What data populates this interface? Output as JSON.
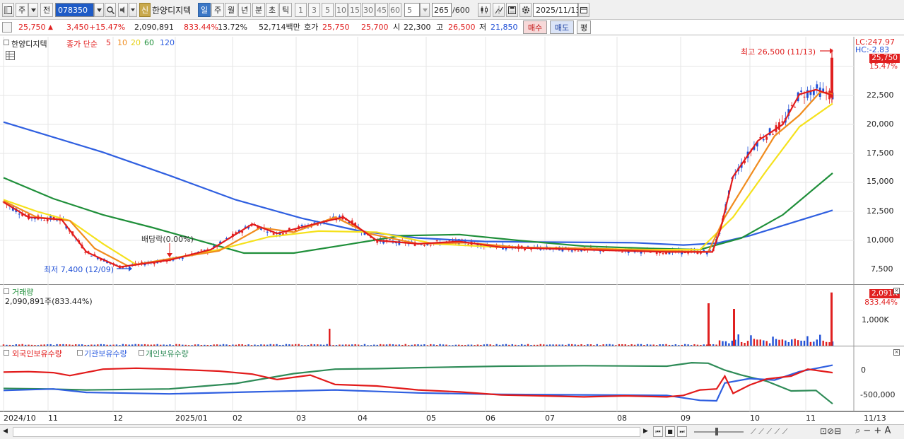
{
  "toolbar": {
    "mode": "주",
    "prev_label": "전",
    "code": "078350",
    "new_badge": "신",
    "stock_name": "한양디지텍",
    "periods": [
      "일",
      "주",
      "월",
      "년",
      "분",
      "초",
      "틱"
    ],
    "minutes": [
      "1",
      "3",
      "5",
      "10",
      "15",
      "30",
      "45",
      "60"
    ],
    "interval_value": "5",
    "count": "265",
    "count_max": "/600",
    "date": "2025/11/13",
    "icons": [
      "window-icon",
      "dropdown-icon",
      "search-icon",
      "speaker-icon",
      "chart-toggle-icon",
      "crosshair-icon",
      "save-icon",
      "settings-icon"
    ]
  },
  "quote": {
    "price": "25,750",
    "change": "3,450",
    "change_pct": "+15.47%",
    "volume": "2,090,891",
    "volume_pct": "833.44%",
    "turnover": "13.72%",
    "amount": "52,714백만",
    "hoga_label": "호가",
    "ask": "25,750",
    "bid": "25,700",
    "open_label": "시",
    "open": "22,300",
    "high_label": "고",
    "high": "26,500",
    "low_label": "저",
    "low": "21,850",
    "buy_label": "매수",
    "sell_label": "매도",
    "eval_label": "평"
  },
  "price_pane": {
    "name": "한양디지텍",
    "series_label": "종가 단순",
    "ma_periods": [
      "5",
      "10",
      "20",
      "60",
      "120"
    ],
    "ma_colors": [
      "#e21b1b",
      "#f08c1e",
      "#f5e11c",
      "#1f8f3a",
      "#2f5fe0"
    ],
    "lc": "LC:247.97",
    "hc": "HC:-2.83",
    "price_tag": "25,750",
    "pct_tag": "15.47%",
    "high_note": "최고 26,500 (11/13)",
    "low_note": "최저 7,400 (12/09)",
    "dividend_note": "배당락(0.00%)",
    "y_ticks": [
      "22,500",
      "20,000",
      "17,500",
      "15,000",
      "12,500",
      "10,000",
      "7,500"
    ]
  },
  "volume_pane": {
    "title": "거래량",
    "value": "2,090,891주(833.44%)",
    "tag": "2,091K",
    "tag_pct": "833.44%",
    "y_ticks": [
      "1,000K"
    ]
  },
  "holding_pane": {
    "series": [
      {
        "name": "외국인보유수량",
        "color": "#e21b1b"
      },
      {
        "name": "기관보유수량",
        "color": "#2f5fe0"
      },
      {
        "name": "개인보유수량",
        "color": "#2e8b57"
      }
    ],
    "y_ticks": [
      "0",
      "-500,000"
    ]
  },
  "xaxis": {
    "labels": [
      "2024/10",
      "11",
      "12",
      "2025/01",
      "02",
      "03",
      "04",
      "05",
      "06",
      "07",
      "08",
      "09",
      "10",
      "11"
    ],
    "end_label": "11/13"
  },
  "colors": {
    "up": "#e02020",
    "down": "#1f4fd6",
    "accent": "#3b77c6"
  },
  "chart_data": {
    "type": "line",
    "title": "한양디지텍",
    "x": [
      "2024/10",
      "11",
      "12",
      "2025/01",
      "02",
      "03",
      "04",
      "05",
      "06",
      "07",
      "08",
      "09",
      "10",
      "11"
    ],
    "series": [
      {
        "name": "MA5",
        "values": [
          13000,
          11800,
          7900,
          9000,
          9900,
          10700,
          10500,
          9700,
          9400,
          9500,
          9300,
          9200,
          19500,
          22800
        ]
      },
      {
        "name": "MA120",
        "values": [
          20200,
          18000,
          15000,
          12700,
          11200,
          10500,
          10200,
          10000,
          9900,
          9900,
          9800,
          9700,
          10600,
          12600
        ]
      }
    ],
    "volume": [
      60,
      80,
      120,
      90,
      110,
      150,
      130,
      80,
      50,
      60,
      70,
      90,
      900,
      2091
    ],
    "ylim": [
      6500,
      27500
    ],
    "high": 26500,
    "low": 7400,
    "last": 25750
  }
}
